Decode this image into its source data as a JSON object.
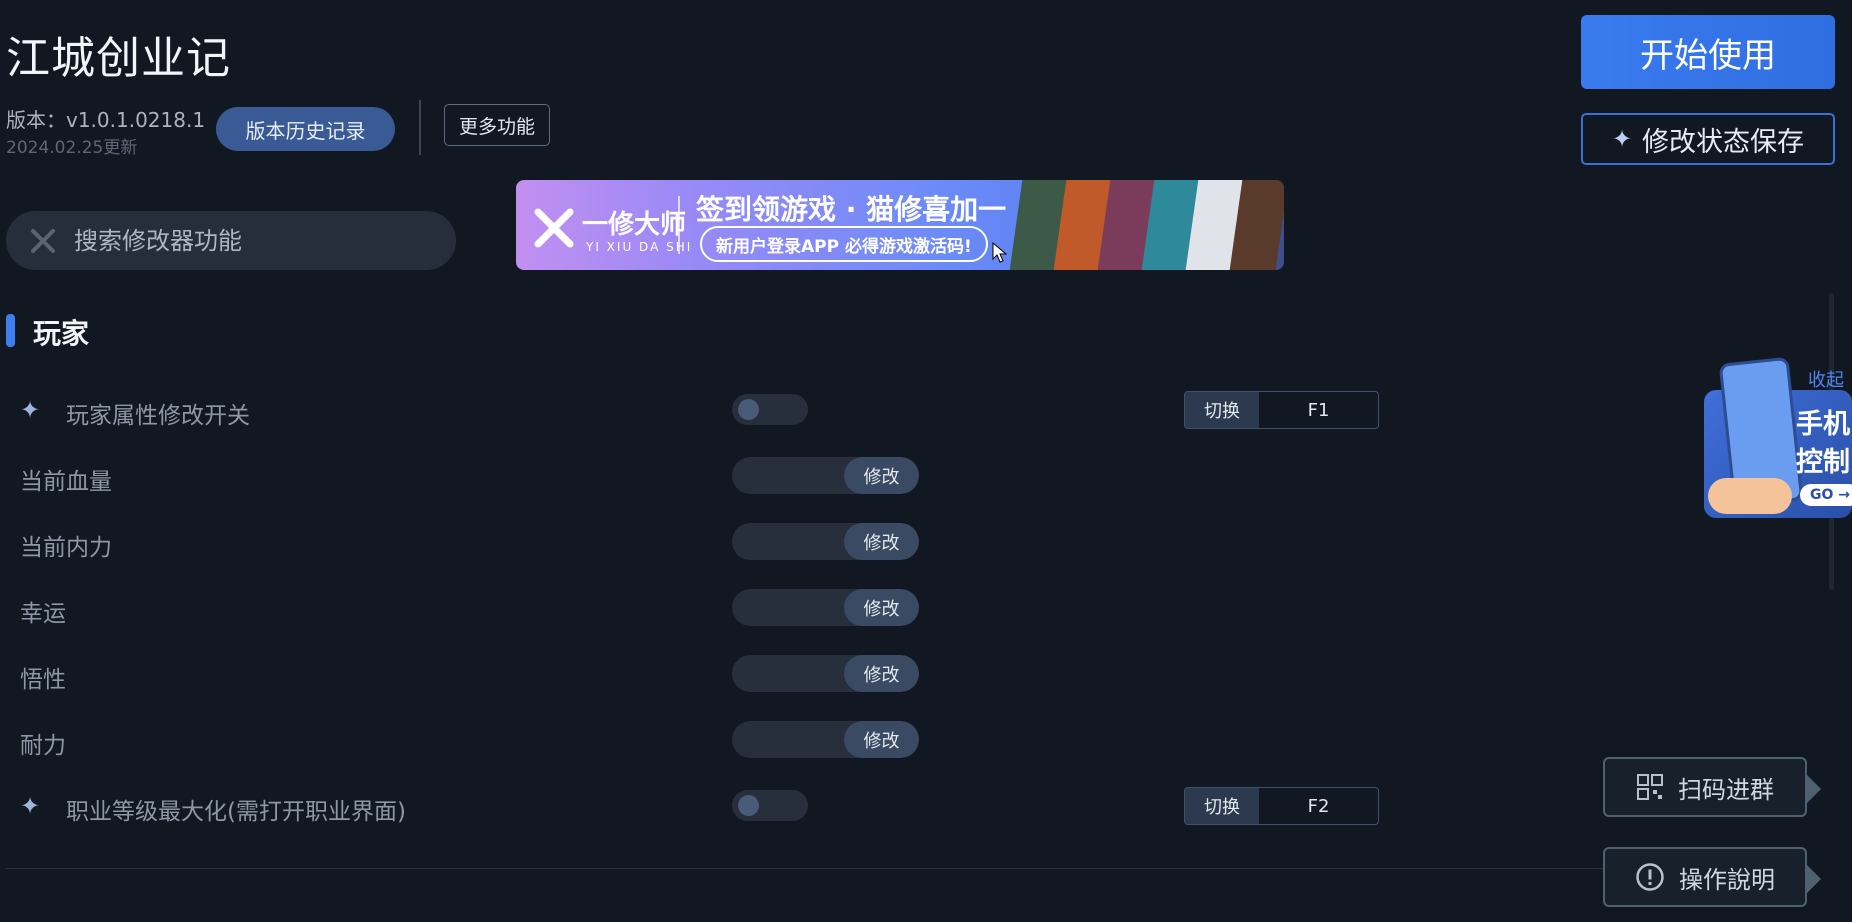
{
  "header": {
    "title": "江城创业记",
    "version": "版本：v1.0.1.0218.1",
    "updated": "2024.02.25更新",
    "history_label": "版本历史记录",
    "more_label": "更多功能"
  },
  "actions": {
    "start_label": "开始使用",
    "save_label": "修改状态保存"
  },
  "search": {
    "placeholder": "搜索修改器功能"
  },
  "banner": {
    "brand": "一修大师",
    "brand_pinyin": "YI XIU DA SHI",
    "headline": "签到领游戏 · 猫修喜加一",
    "sub": "新用户登录APP  必得游戏激活码!"
  },
  "section": {
    "title": "玩家"
  },
  "rows": [
    {
      "label": "玩家属性修改开关",
      "type": "toggle",
      "key_label": "切换",
      "key": "F1"
    },
    {
      "label": "当前血量",
      "type": "edit",
      "button": "修改"
    },
    {
      "label": "当前内力",
      "type": "edit",
      "button": "修改"
    },
    {
      "label": "幸运",
      "type": "edit",
      "button": "修改"
    },
    {
      "label": "悟性",
      "type": "edit",
      "button": "修改"
    },
    {
      "label": "耐力",
      "type": "edit",
      "button": "修改"
    },
    {
      "label": "职业等级最大化(需打开职业界面)",
      "type": "toggle",
      "key_label": "切换",
      "key": "F2"
    }
  ],
  "side_panel": {
    "collapse_label": "收起",
    "card_text_1": "手机",
    "card_text_2": "控制",
    "card_go": "GO →",
    "qr_label": "扫码进群",
    "help_label": "操作說明"
  },
  "colors": {
    "accent": "#3d7ff0",
    "background": "#121822"
  }
}
